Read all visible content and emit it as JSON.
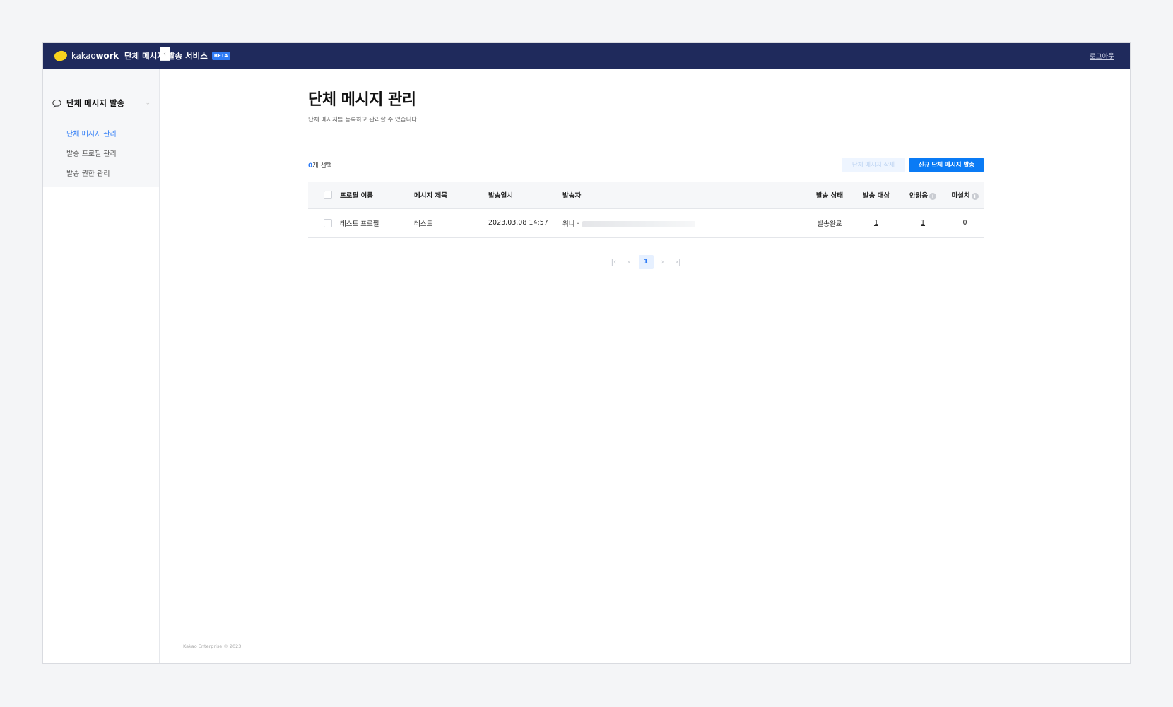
{
  "header": {
    "brand_light": "kakao",
    "brand_bold": "work",
    "service_title": "단체 메시지 발송 서비스",
    "badge": "BETA",
    "logout": "로그아웃"
  },
  "sidebar": {
    "group_label": "단체 메시지 발송",
    "items": [
      {
        "label": "단체 메시지 관리",
        "active": true
      },
      {
        "label": "발송 프로필 관리",
        "active": false
      },
      {
        "label": "발송 권한 관리",
        "active": false
      }
    ]
  },
  "main": {
    "title": "단체 메시지 관리",
    "description": "단체 메시지를 등록하고 관리할 수 있습니다.",
    "selected_count": "0",
    "selected_suffix": "개 선택",
    "delete_button": "단체 메시지 삭제",
    "new_button": "신규 단체 메시지 발송",
    "columns": [
      "프로필 이름",
      "메시지 제목",
      "발송일시",
      "발송자",
      "발송 상태",
      "발송 대상",
      "안읽음",
      "미설치"
    ],
    "rows": [
      {
        "profile": "테스트 프로필",
        "subject": "테스트",
        "sent_at": "2023.03.08 14:57",
        "sender": "위니 ·",
        "status": "발송완료",
        "targets": "1",
        "unread": "1",
        "not_installed": "0"
      }
    ],
    "pagination": {
      "current": "1"
    }
  },
  "footer": {
    "copyright": "Kakao Enterprise © 2023"
  },
  "colors": {
    "topbar": "#1f2a5c",
    "accent": "#0a7bf5",
    "logo": "#f7d21e"
  }
}
